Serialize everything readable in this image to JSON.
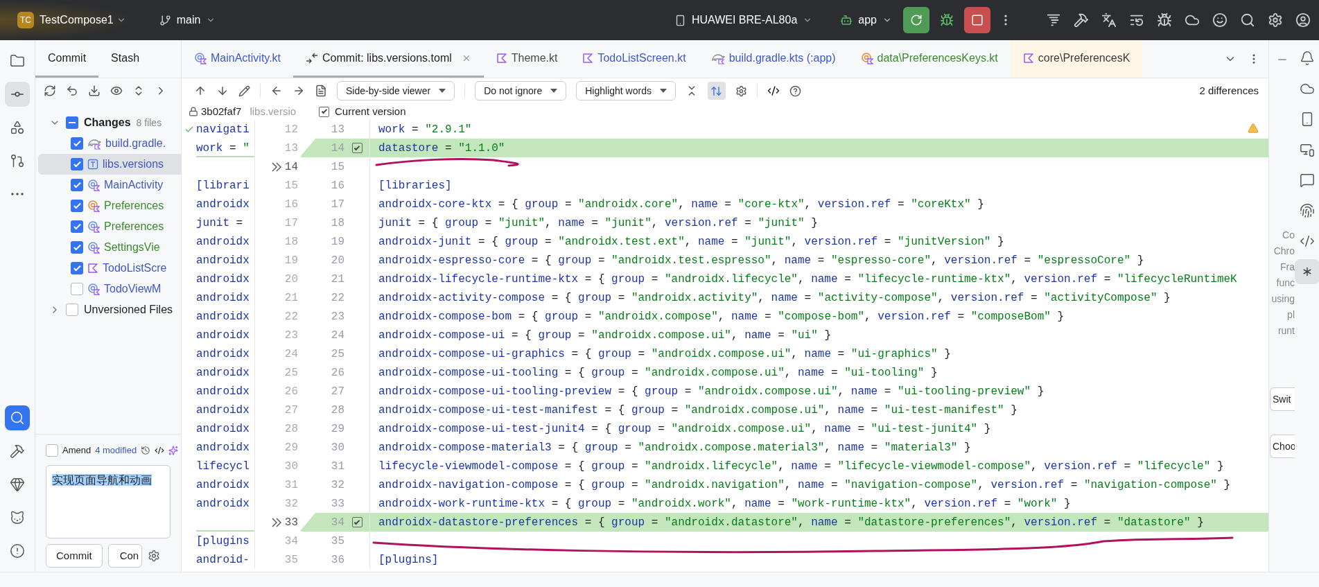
{
  "top_bar": {
    "project_initials": "TC",
    "project": "TestCompose1",
    "branch": "main",
    "device": "HUAWEI BRE-AL80a",
    "run_config": "app"
  },
  "left_toolbar": [
    {
      "kind": "folder",
      "selected": false
    },
    {
      "kind": "commit",
      "selected": true
    },
    {
      "kind": "shapes",
      "selected": false
    },
    {
      "kind": "pull",
      "selected": false
    },
    {
      "kind": "more",
      "selected": false
    }
  ],
  "left_toolbar_bottom": [
    {
      "kind": "search",
      "selected": true
    },
    {
      "kind": "hammer",
      "selected": false
    },
    {
      "kind": "gem",
      "selected": false
    },
    {
      "kind": "cat",
      "selected": false
    },
    {
      "kind": "alert",
      "selected": false
    }
  ],
  "commit_panel": {
    "tabs": [
      {
        "label": "Commit",
        "selected": true
      },
      {
        "label": "Stash",
        "selected": false
      }
    ],
    "changes": {
      "label": "Changes",
      "count": "8 files",
      "expanded": true,
      "indeterminate": true,
      "children": [
        {
          "label": "build.gradle.",
          "kind": "gradle",
          "color": "#3d57c9",
          "checked": true,
          "selected": false
        },
        {
          "label": "libs.versions",
          "kind": "toml",
          "color": "#3d57c9",
          "checked": true,
          "selected": true
        },
        {
          "label": "MainActivity",
          "kind": "class",
          "color": "#3d57c9",
          "checked": true,
          "selected": false
        },
        {
          "label": "Preferences",
          "kind": "object",
          "color": "#3b8a2e",
          "checked": true,
          "selected": false
        },
        {
          "label": "Preferences",
          "kind": "class",
          "color": "#3b8a2e",
          "checked": true,
          "selected": false
        },
        {
          "label": "SettingsVie",
          "kind": "class",
          "color": "#3b8a2e",
          "checked": true,
          "selected": false
        },
        {
          "label": "TodoListScre",
          "kind": "kotlin",
          "color": "#3d57c9",
          "checked": true,
          "selected": false
        },
        {
          "label": "TodoViewM",
          "kind": "class",
          "color": "#3d57c9",
          "checked": false,
          "selected": false
        }
      ]
    },
    "unversioned": {
      "label": "Unversioned Files",
      "expanded": false,
      "checked": false
    },
    "amend": {
      "label": "Amend",
      "checked": false
    },
    "summary": "4 modified",
    "message": "实现页面导航和动画",
    "buttons": [
      "Commit",
      "Con"
    ]
  },
  "editor_tabs": [
    {
      "label": "MainActivity.kt",
      "kind": "class",
      "color": "#3d57c9",
      "selected": false,
      "tinted": false
    },
    {
      "label": "Commit: libs.versions.toml",
      "kind": "diff",
      "color": "#1f1f1f",
      "selected": true,
      "tinted": false
    },
    {
      "label": "Theme.kt",
      "kind": "kotlin",
      "color": "#4a4a4a",
      "selected": false,
      "tinted": false
    },
    {
      "label": "TodoListScreen.kt",
      "kind": "kotlin",
      "color": "#3d57c9",
      "selected": false,
      "tinted": false
    },
    {
      "label": "build.gradle.kts (:app)",
      "kind": "gradle",
      "color": "#3d57c9",
      "selected": false,
      "tinted": false
    },
    {
      "label": "data\\PreferencesKeys.kt",
      "kind": "object",
      "color": "#3b8a2e",
      "selected": false,
      "tinted": false
    },
    {
      "label": "core\\PreferencesK",
      "kind": "kotlin",
      "color": "#3a3a3a",
      "selected": false,
      "tinted": true
    }
  ],
  "diff_toolbar": {
    "viewer": "Side-by-side viewer",
    "ignore": "Do not ignore",
    "highlight": "Highlight words",
    "sync_scroll": true,
    "differences": "2 differences"
  },
  "diff_header": {
    "revision": "3b02faf7",
    "left_file": "libs.versio",
    "current_version": {
      "label": "Current version",
      "checked": true
    }
  },
  "diff_rows": [
    {
      "left_code": "navigati",
      "left_line": "12",
      "right_line": "13",
      "right_code": "work = \"2.9.1\""
    },
    {
      "left_code": "work = \"",
      "left_line": "13",
      "right_line": "14",
      "right_code": "datastore = \"1.1.0\"",
      "inserted": true,
      "checked": true
    },
    {
      "left_line": "14",
      "right_line": "15",
      "revert_arrow": true
    },
    {
      "left_code": "[librari",
      "left_line": "15",
      "right_line": "16",
      "right_code": "[libraries]"
    },
    {
      "left_code": "androidx",
      "left_line": "16",
      "right_line": "17",
      "right_code": "androidx-core-ktx = { group = \"androidx.core\", name = \"core-ktx\", version.ref = \"coreKtx\" }"
    },
    {
      "left_code": "junit =",
      "left_line": "17",
      "right_line": "18",
      "right_code": "junit = { group = \"junit\", name = \"junit\", version.ref = \"junit\" }"
    },
    {
      "left_code": "androidx",
      "left_line": "18",
      "right_line": "19",
      "right_code": "androidx-junit = { group = \"androidx.test.ext\", name = \"junit\", version.ref = \"junitVersion\" }"
    },
    {
      "left_code": "androidx",
      "left_line": "19",
      "right_line": "20",
      "right_code": "androidx-espresso-core = { group = \"androidx.test.espresso\", name = \"espresso-core\", version.ref = \"espressoCore\" }"
    },
    {
      "left_code": "androidx",
      "left_line": "20",
      "right_line": "21",
      "right_code": "androidx-lifecycle-runtime-ktx = { group = \"androidx.lifecycle\", name = \"lifecycle-runtime-ktx\", version.ref = \"lifecycleRuntimeK"
    },
    {
      "left_code": "androidx",
      "left_line": "21",
      "right_line": "22",
      "right_code": "androidx-activity-compose = { group = \"androidx.activity\", name = \"activity-compose\", version.ref = \"activityCompose\" }"
    },
    {
      "left_code": "androidx",
      "left_line": "22",
      "right_line": "23",
      "right_code": "androidx-compose-bom = { group = \"androidx.compose\", name = \"compose-bom\", version.ref = \"composeBom\" }"
    },
    {
      "left_code": "androidx",
      "left_line": "23",
      "right_line": "24",
      "right_code": "androidx-compose-ui = { group = \"androidx.compose.ui\", name = \"ui\" }"
    },
    {
      "left_code": "androidx",
      "left_line": "24",
      "right_line": "25",
      "right_code": "androidx-compose-ui-graphics = { group = \"androidx.compose.ui\", name = \"ui-graphics\" }"
    },
    {
      "left_code": "androidx",
      "left_line": "25",
      "right_line": "26",
      "right_code": "androidx-compose-ui-tooling = { group = \"androidx.compose.ui\", name = \"ui-tooling\" }"
    },
    {
      "left_code": "androidx",
      "left_line": "26",
      "right_line": "27",
      "right_code": "androidx-compose-ui-tooling-preview = { group = \"androidx.compose.ui\", name = \"ui-tooling-preview\" }"
    },
    {
      "left_code": "androidx",
      "left_line": "27",
      "right_line": "28",
      "right_code": "androidx-compose-ui-test-manifest = { group = \"androidx.compose.ui\", name = \"ui-test-manifest\" }"
    },
    {
      "left_code": "androidx",
      "left_line": "28",
      "right_line": "29",
      "right_code": "androidx-compose-ui-test-junit4 = { group = \"androidx.compose.ui\", name = \"ui-test-junit4\" }"
    },
    {
      "left_code": "androidx",
      "left_line": "29",
      "right_line": "30",
      "right_code": "androidx-compose-material3 = { group = \"androidx.compose.material3\", name = \"material3\" }"
    },
    {
      "left_code": "lifecycl",
      "left_line": "30",
      "right_line": "31",
      "right_code": "lifecycle-viewmodel-compose = { group = \"androidx.lifecycle\", name = \"lifecycle-viewmodel-compose\", version.ref = \"lifecycle\" }"
    },
    {
      "left_code": "androidx",
      "left_line": "31",
      "right_line": "32",
      "right_code": "androidx-navigation-compose = { group = \"androidx.navigation\", name = \"navigation-compose\", version.ref = \"navigation-compose\" }"
    },
    {
      "left_code": "androidx",
      "left_line": "32",
      "right_line": "33",
      "right_code": "androidx-work-runtime-ktx = { group = \"androidx.work\", name = \"work-runtime-ktx\", version.ref = \"work\" }"
    },
    {
      "left_line": "33",
      "right_line": "34",
      "right_code": "androidx-datastore-preferences = { group = \"androidx.datastore\", name = \"datastore-preferences\", version.ref = \"datastore\" }",
      "inserted": true,
      "checked": true,
      "revert_arrow": true
    },
    {
      "left_code": "[plugins",
      "left_line": "34",
      "right_line": "35"
    },
    {
      "left_code": "android-",
      "left_line": "35",
      "right_line": "36",
      "right_code": "[plugins]"
    }
  ],
  "side_panel": {
    "lines": [
      "Co",
      "Chro",
      "Fra",
      "func",
      "using",
      "pl",
      "runt"
    ],
    "buttons": [
      "Swit",
      "Choo"
    ]
  },
  "right_toolbar": [
    {
      "kind": "bell",
      "selected": false
    },
    {
      "kind": "cloud",
      "selected": false
    },
    {
      "kind": "phone",
      "selected": false
    },
    {
      "kind": "devices",
      "selected": false
    },
    {
      "kind": "chat",
      "selected": false
    },
    {
      "kind": "fingerprint",
      "selected": false
    },
    {
      "kind": "code",
      "selected": false
    },
    {
      "kind": "asterisk",
      "selected": true
    }
  ]
}
